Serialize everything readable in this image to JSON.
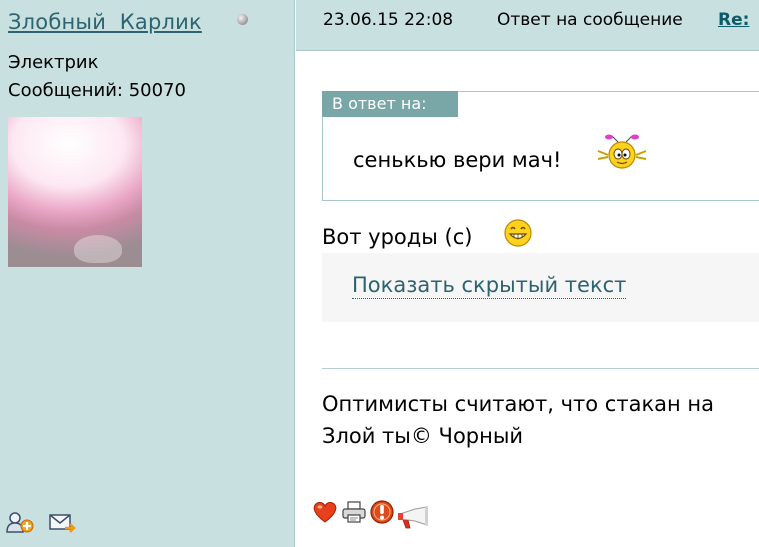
{
  "author": {
    "name": "Злобный  Карлик",
    "rank": "Электрик",
    "posts_label": "Сообщений:",
    "posts_count": "50070"
  },
  "post": {
    "date": "23.06.15 22:08",
    "action": "Ответ на сообщение",
    "link": "Re:",
    "quote_label": "В ответ на:",
    "quote_text": "сенькью вери мач!",
    "body": "Вот уроды (с)",
    "spoiler_toggle": "Показать скрытый текст",
    "signature_line1": "Оптимисты считают, что стакан на",
    "signature_line2": "Злой ты© Чорный"
  },
  "icons": {
    "status": "status-dot-icon",
    "add_friend": "add-user-icon",
    "send_message": "envelope-icon",
    "like": "heart-icon",
    "print": "printer-icon",
    "report": "warning-icon",
    "announce": "megaphone-icon"
  },
  "colors": {
    "sidebar_bg": "#c8e0e0",
    "username_link": "#2e6470",
    "post_link": "#0d5a66",
    "quote_label_bg": "#79a6a6"
  }
}
